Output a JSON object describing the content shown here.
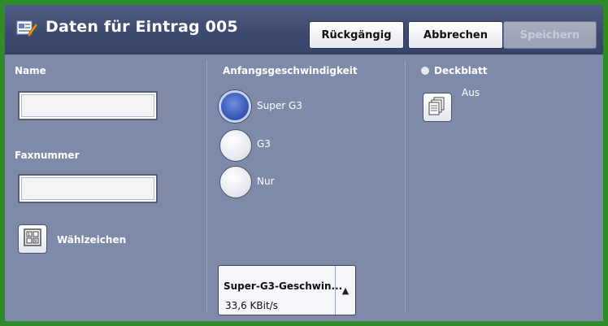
{
  "header": {
    "title": "Daten für Eintrag 005",
    "buttons": {
      "undo": "Rückgängig",
      "cancel": "Abbrechen",
      "save": "Speichern"
    }
  },
  "left": {
    "name_label": "Name",
    "name_value": "",
    "fax_label": "Faxnummer",
    "fax_value": "",
    "dial_chars_label": "Wählzeichen"
  },
  "middle": {
    "speed_label": "Anfangsgeschwindigkeit",
    "options": [
      "Super G3",
      "G3",
      "Nur"
    ],
    "selected_option": "Super G3",
    "dropdown_title": "Super-G3-Geschwin...",
    "dropdown_value": "33,6 KBit/s"
  },
  "right": {
    "cover_label": "Deckblatt",
    "cover_value": "Aus"
  },
  "colors": {
    "background": "#7f8aa9",
    "header": "#3f4a70",
    "frame": "#2f8a2a",
    "selected_radio": "#3a5ab8"
  }
}
